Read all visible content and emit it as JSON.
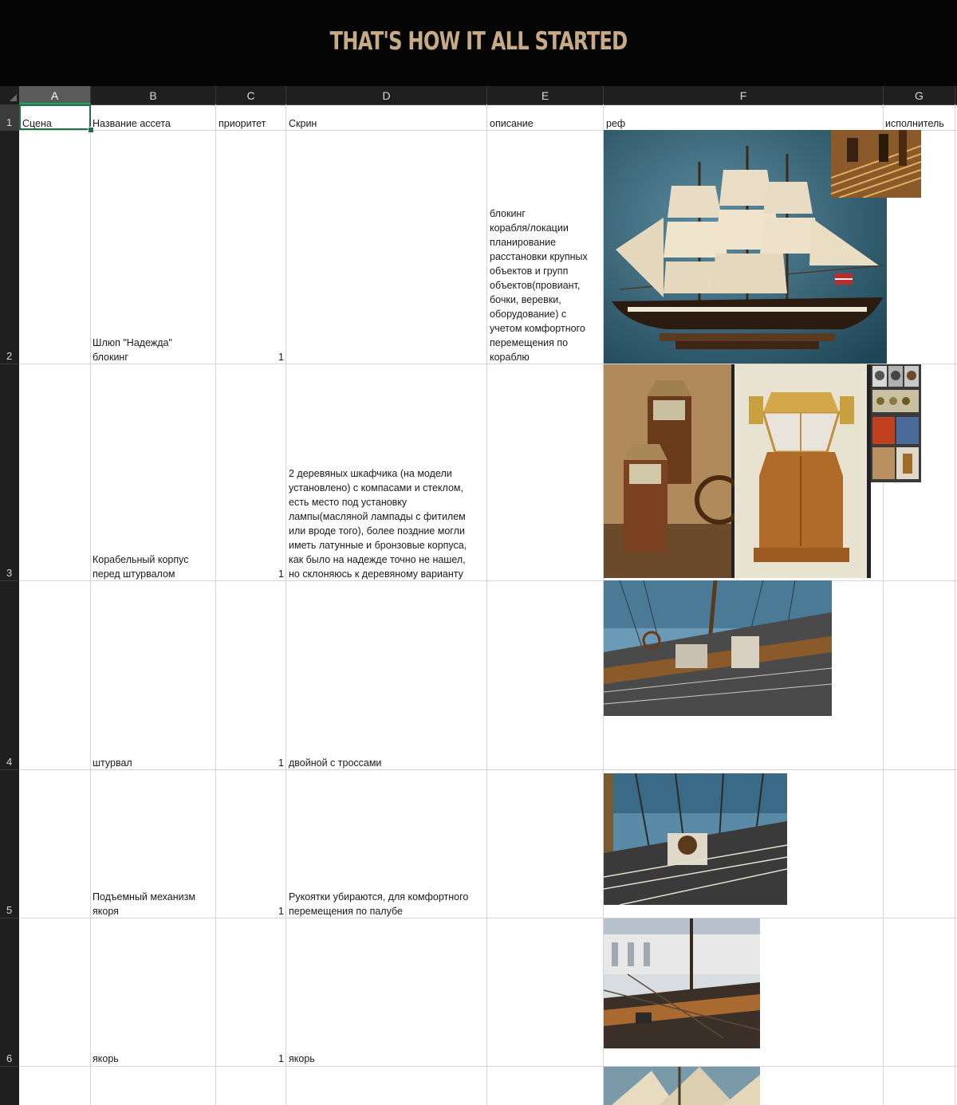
{
  "banner": {
    "title": "THAT'S HOW IT ALL STARTED"
  },
  "columns": [
    "A",
    "B",
    "C",
    "D",
    "E",
    "F",
    "G"
  ],
  "rows": [
    "1",
    "2",
    "3",
    "4",
    "5",
    "6"
  ],
  "header_row": {
    "scene": "Сцена",
    "asset_name": "Название ассета",
    "priority": "приоритет",
    "screen": "Скрин",
    "description": "описание",
    "ref": "реф",
    "assignee": "исполнитель"
  },
  "data_rows": [
    {
      "asset_name": "Шлюп \"Надежда\"\nблокинг",
      "priority": "1",
      "screen": "",
      "description": "блокинг\nкорабля/локации\nпланирование\nрасстановки крупных\nобъектов и групп\nобъектов(провиант,\nбочки, веревки,\nоборудование) с\nучетом комфортного\nперемещения по\nкораблю"
    },
    {
      "asset_name": "Корабельный корпус\nперед штурвалом",
      "priority": "1",
      "screen": "2 деревяных шкафчика (на модели\nустановлено) с компасами и стеклом,\nесть место под установку\nлампы(масляной лампады с фитилем\nили вроде того), более поздние могли\nиметь латунные и бронзовые корпуса,\nкак было на надежде точно не нашел,\nно склоняюсь к деревяному варианту",
      "description": ""
    },
    {
      "asset_name": "штурвал",
      "priority": "1",
      "screen": " двойной с троссами",
      "description": ""
    },
    {
      "asset_name": "Подъемный механизм\nякоря",
      "priority": "1",
      "screen": "Рукоятки убираются, для комфортного\nперемещения по палубе",
      "description": ""
    },
    {
      "asset_name": "якорь",
      "priority": "1",
      "screen": "якорь",
      "description": ""
    }
  ]
}
